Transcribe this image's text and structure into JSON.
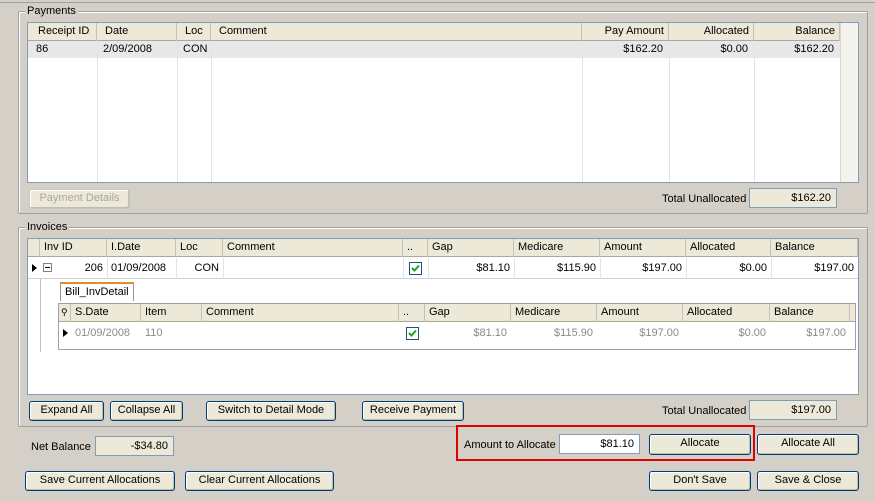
{
  "payments": {
    "title": "Payments",
    "columns": [
      "Receipt ID",
      "Date",
      "Loc",
      "Comment",
      "Pay Amount",
      "Allocated",
      "Balance"
    ],
    "rows": [
      {
        "receipt_id": "86",
        "date": "2/09/2008",
        "loc": "CON",
        "comment": "",
        "pay_amount": "$162.20",
        "allocated": "$0.00",
        "balance": "$162.20"
      }
    ],
    "payment_details_label": "Payment Details",
    "total_unallocated_label": "Total Unallocated",
    "total_unallocated_value": "$162.20"
  },
  "invoices": {
    "title": "Invoices",
    "columns": [
      "Inv ID",
      "I.Date",
      "Loc",
      "Comment",
      "..",
      "Gap",
      "Medicare",
      "Amount",
      "Allocated",
      "Balance"
    ],
    "rows": [
      {
        "inv_id": "206",
        "date": "01/09/2008",
        "loc": "CON",
        "comment": "",
        "checked": true,
        "gap": "$81.10",
        "medicare": "$115.90",
        "amount": "$197.00",
        "allocated": "$0.00",
        "balance": "$197.00"
      }
    ],
    "detail": {
      "tab_label": "Bill_InvDetail",
      "columns": [
        "S.Date",
        "Item",
        "Comment",
        "..",
        "Gap",
        "Medicare",
        "Amount",
        "Allocated",
        "Balance"
      ],
      "rows": [
        {
          "date": "01/09/2008",
          "item": "110",
          "comment": "",
          "checked": true,
          "gap": "$81.10",
          "medicare": "$115.90",
          "amount": "$197.00",
          "allocated": "$0.00",
          "balance": "$197.00"
        }
      ]
    },
    "expand_all_label": "Expand All",
    "collapse_all_label": "Collapse All",
    "switch_mode_label": "Switch to Detail Mode",
    "receive_payment_label": "Receive Payment",
    "total_unallocated_label": "Total Unallocated",
    "total_unallocated_value": "$197.00"
  },
  "footer": {
    "net_balance_label": "Net Balance",
    "net_balance_value": "-$34.80",
    "amount_to_allocate_label": "Amount to Allocate",
    "amount_to_allocate_value": "$81.10",
    "allocate_label": "Allocate",
    "allocate_all_label": "Allocate All",
    "save_current_label": "Save Current Allocations",
    "clear_current_label": "Clear Current Allocations",
    "dont_save_label": "Don't Save",
    "save_close_label": "Save & Close",
    "highlight_color": "#e00000"
  }
}
